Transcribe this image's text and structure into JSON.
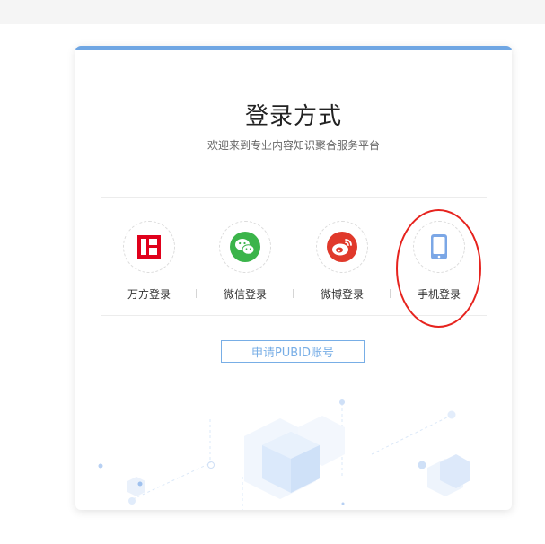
{
  "login": {
    "title": "登录方式",
    "subtitle": "欢迎来到专业内容知识聚合服务平台",
    "methods": [
      {
        "label": "万方登录",
        "icon": "wanfang-logo-icon"
      },
      {
        "label": "微信登录",
        "icon": "wechat-icon"
      },
      {
        "label": "微博登录",
        "icon": "weibo-icon"
      },
      {
        "label": "手机登录",
        "icon": "phone-icon"
      }
    ],
    "pubid_button": "申请PUBID账号"
  },
  "colors": {
    "accent": "#6fa6e3",
    "wanfang_red": "#e0001b",
    "wechat_green": "#3bb44a",
    "weibo_red": "#e0392b",
    "phone_blue": "#7ba7e6",
    "annotation_red": "#e6231e"
  }
}
